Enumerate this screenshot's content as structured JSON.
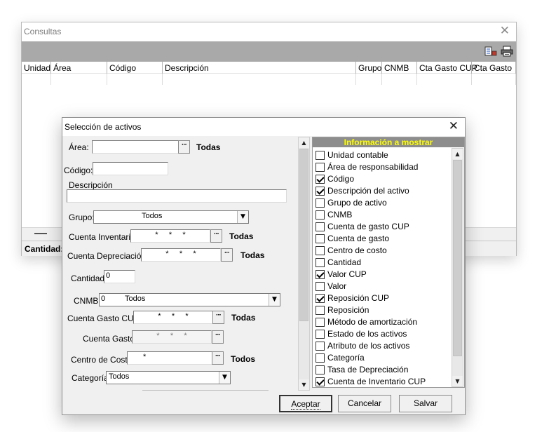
{
  "consultas": {
    "title": "Consultas",
    "columns": [
      "Unidad",
      "Área",
      "Código",
      "Descripción",
      "Grupo",
      "CNMB",
      "Cta Gasto CUP",
      "Cta Gasto"
    ],
    "status_label": "Cantidad:",
    "toolbar_icons": [
      "fields-icon",
      "printer-icon"
    ]
  },
  "dialog": {
    "title": "Selección de activos",
    "fields": {
      "area_label": "Área:",
      "area_value": "",
      "area_all": "Todas",
      "codigo_label": "Código:",
      "codigo_value": "",
      "descripcion_label": "Descripción",
      "descripcion_value": "",
      "grupo_label": "Grupo:",
      "grupo_value": "Todos",
      "cuenta_inv_label": "Cuenta Inventario",
      "cuenta_inv_value": "*     *     *",
      "cuenta_inv_all": "Todas",
      "cuenta_dep_label": "Cuenta Depreciación",
      "cuenta_dep_value": "*     *     *",
      "cuenta_dep_all": "Todas",
      "cantidad_label": "Cantidad",
      "cantidad_value": "0",
      "cnmb_label": "CNMB:",
      "cnmb_code": "0",
      "cnmb_value": "Todos",
      "cta_gasto_cup_label": "Cuenta Gasto CUP",
      "cta_gasto_cup_value": "*     *     *",
      "cta_gasto_cup_all": "Todas",
      "cta_gasto_label": "Cuenta Gasto",
      "cta_gasto_value": "*     *     *",
      "centro_costo_label": "Centro de Costo",
      "centro_costo_value": "*",
      "centro_costo_all": "Todos",
      "categoria_label": "Categoría",
      "categoria_value": "Todos"
    },
    "info": {
      "header": "Información a mostrar",
      "items": [
        {
          "label": "Unidad contable",
          "checked": false
        },
        {
          "label": "Área de responsabilidad",
          "checked": false
        },
        {
          "label": "Código",
          "checked": true
        },
        {
          "label": "Descripción del activo",
          "checked": true
        },
        {
          "label": "Grupo de activo",
          "checked": false
        },
        {
          "label": "CNMB",
          "checked": false
        },
        {
          "label": "Cuenta de gasto CUP",
          "checked": false
        },
        {
          "label": "Cuenta de gasto",
          "checked": false
        },
        {
          "label": "Centro de costo",
          "checked": false
        },
        {
          "label": "Cantidad",
          "checked": false
        },
        {
          "label": "Valor CUP",
          "checked": true
        },
        {
          "label": "Valor",
          "checked": false
        },
        {
          "label": "Reposición CUP",
          "checked": true
        },
        {
          "label": "Reposición",
          "checked": false
        },
        {
          "label": "Método de amortización",
          "checked": false
        },
        {
          "label": "Estado de los activos",
          "checked": false
        },
        {
          "label": "Atributo de los  activos",
          "checked": false
        },
        {
          "label": "Categoría",
          "checked": false
        },
        {
          "label": "Tasa de Depreciación",
          "checked": false
        },
        {
          "label": "Cuenta de Inventario CUP",
          "checked": true
        }
      ]
    },
    "buttons": {
      "accept": "Aceptar",
      "cancel": "Cancelar",
      "save": "Salvar"
    }
  }
}
